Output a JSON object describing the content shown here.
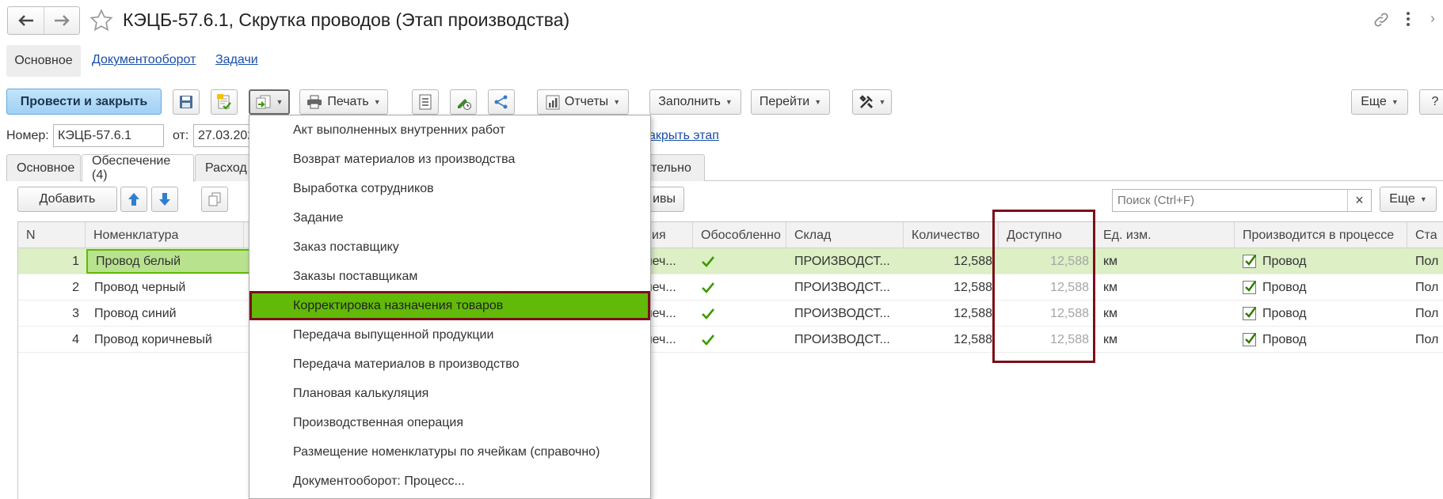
{
  "window": {
    "title": "КЭЦБ-57.6.1, Скрутка проводов (Этап производства)"
  },
  "nav_tabs": [
    "Основное",
    "Документооборот",
    "Задачи"
  ],
  "toolbar": {
    "post_close": "Провести и закрыть",
    "print": "Печать",
    "reports": "Отчеты",
    "fill": "Заполнить",
    "goto": "Перейти",
    "more": "Еще",
    "help": "?"
  },
  "form": {
    "number_label": "Номер:",
    "number_value": "КЭЦБ-57.6.1",
    "date_label": "от:",
    "date_value": "27.03.202",
    "close_stage_link": "акрыть этап"
  },
  "doc_tabs": [
    "Основное",
    "Обеспечение (4)",
    "Расход",
    "ительно"
  ],
  "table_toolbar": {
    "add": "Добавить",
    "partial": "ивы",
    "search_placeholder": "Поиск (Ctrl+F)",
    "more": "Еще"
  },
  "table": {
    "headers": {
      "n": "N",
      "nomenclature": "Номенклатура",
      "char": "ия",
      "separate": "Обособленно",
      "warehouse": "Склад",
      "quantity": "Количество",
      "available": "Доступно",
      "unit": "Ед. изм.",
      "in_process": "Производится в процессе",
      "status": "Ста"
    },
    "rows": [
      {
        "n": "1",
        "name": "Провод белый",
        "char": "печ...",
        "warehouse": "ПРОИЗВОДСТ...",
        "qty": "12,588",
        "avail": "12,588",
        "unit": "км",
        "process": "Провод",
        "status": "Пол"
      },
      {
        "n": "2",
        "name": "Провод черный",
        "char": "печ...",
        "warehouse": "ПРОИЗВОДСТ...",
        "qty": "12,588",
        "avail": "12,588",
        "unit": "км",
        "process": "Провод",
        "status": "Пол"
      },
      {
        "n": "3",
        "name": "Провод синий",
        "char": "печ...",
        "warehouse": "ПРОИЗВОДСТ...",
        "qty": "12,588",
        "avail": "12,588",
        "unit": "км",
        "process": "Провод",
        "status": "Пол"
      },
      {
        "n": "4",
        "name": "Провод коричневый",
        "char": "печ...",
        "warehouse": "ПРОИЗВОДСТ...",
        "qty": "12,588",
        "avail": "12,588",
        "unit": "км",
        "process": "Провод",
        "status": "Пол"
      }
    ]
  },
  "dropdown": {
    "items": [
      "Акт выполненных внутренних работ",
      "Возврат материалов из производства",
      "Выработка сотрудников",
      "Задание",
      "Заказ поставщику",
      "Заказы поставщикам",
      "Корректировка назначения товаров",
      "Передача выпущенной продукции",
      "Передача материалов в производство",
      "Плановая калькуляция",
      "Производственная операция",
      "Размещение номенклатуры по ячейкам (справочно)",
      "Документооборот: Процесс..."
    ],
    "highlighted": "Корректировка назначения товаров"
  },
  "colors": {
    "primary_button": "#a9d6f7",
    "selected_row": "#dcefc5",
    "menu_highlight": "#62ba08",
    "annotation": "#7a1018",
    "check": "#3c9a00"
  },
  "icons": {
    "back": "arrow-left-icon",
    "forward": "arrow-right-icon",
    "favorite": "star-icon",
    "link": "link-icon",
    "more": "vertical-dots-icon"
  }
}
